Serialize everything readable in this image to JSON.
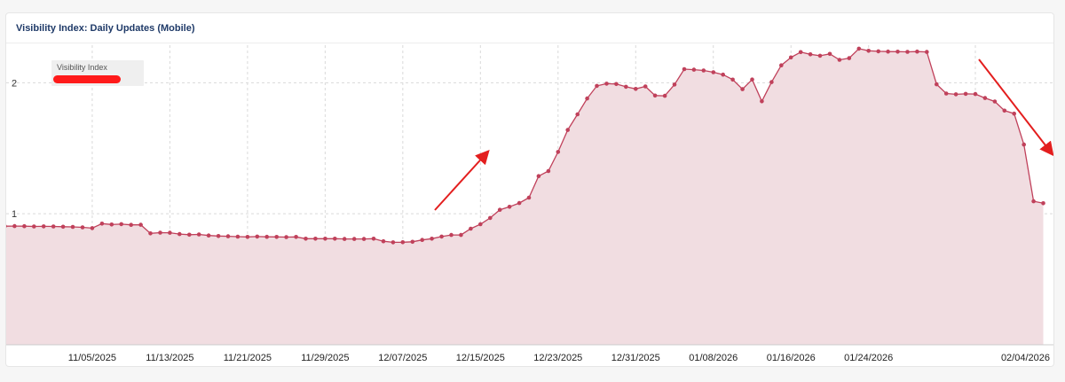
{
  "panel": {
    "title": "Visibility Index: Daily Updates (Mobile)"
  },
  "chart_data": {
    "type": "area",
    "legend": {
      "label": "Visibility Index",
      "position": "top-left"
    },
    "colors": {
      "line": "#c0415b",
      "fill": "#f1dde1",
      "grid": "#d9d9d9",
      "annotation_arrow": "#e31e1e",
      "legend_bg": "#efefef",
      "redaction": "#ff1a1a"
    },
    "grid": true,
    "x_ticks": [
      "11/05/2025",
      "11/13/2025",
      "11/21/2025",
      "11/29/2025",
      "12/07/2025",
      "12/15/2025",
      "12/23/2025",
      "12/31/2025",
      "01/08/2026",
      "01/16/2026",
      "01/24/2026",
      "02/04/2026"
    ],
    "y_ticks": [
      1,
      2
    ],
    "ylim": [
      0,
      2.3
    ],
    "x_start": "2025-10-27",
    "y": [
      0.905,
      0.906,
      0.905,
      0.903,
      0.904,
      0.903,
      0.901,
      0.9,
      0.896,
      0.89,
      0.925,
      0.918,
      0.921,
      0.915,
      0.916,
      0.85,
      0.856,
      0.855,
      0.845,
      0.84,
      0.842,
      0.834,
      0.83,
      0.828,
      0.825,
      0.823,
      0.826,
      0.824,
      0.823,
      0.822,
      0.823,
      0.81,
      0.81,
      0.81,
      0.81,
      0.808,
      0.808,
      0.808,
      0.81,
      0.79,
      0.782,
      0.783,
      0.786,
      0.8,
      0.81,
      0.826,
      0.838,
      0.838,
      0.886,
      0.92,
      0.968,
      1.03,
      1.053,
      1.082,
      1.123,
      1.287,
      1.326,
      1.472,
      1.64,
      1.759,
      1.88,
      1.976,
      1.993,
      1.99,
      1.969,
      1.953,
      1.972,
      1.902,
      1.9,
      1.986,
      2.104,
      2.1,
      2.094,
      2.08,
      2.062,
      2.024,
      1.951,
      2.025,
      1.858,
      2.005,
      2.133,
      2.193,
      2.234,
      2.217,
      2.206,
      2.22,
      2.175,
      2.188,
      2.26,
      2.244,
      2.24,
      2.238,
      2.237,
      2.236,
      2.238,
      2.235,
      1.988,
      1.918,
      1.912,
      1.915,
      1.914,
      1.883,
      1.857,
      1.787,
      1.764,
      1.528,
      1.095,
      1.08
    ]
  }
}
